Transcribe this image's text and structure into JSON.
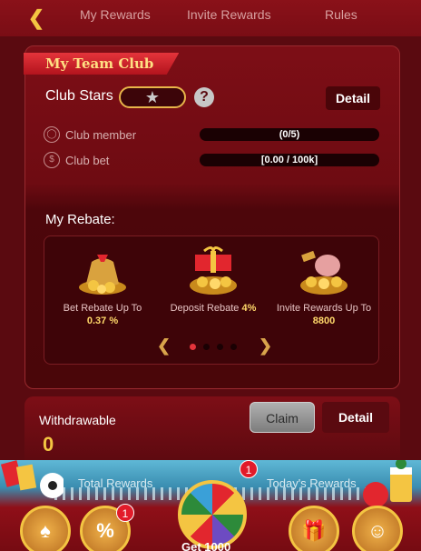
{
  "header": {
    "back_icon": "chevron-left-icon",
    "tabs": [
      "My Rewards",
      "Invite Rewards",
      "Rules"
    ]
  },
  "club": {
    "title": "My Team Club",
    "stars_label": "Club Stars",
    "detail_label": "Detail",
    "member_label": "Club member",
    "member_value": "(0/5)",
    "member_progress": 0,
    "bet_label": "Club bet",
    "bet_value": "[0.00 / 100k]",
    "bet_progress": 0
  },
  "rebate": {
    "title": "My Rebate:",
    "items": [
      {
        "caption": "Bet Rebate Up To",
        "value": "0.37 %"
      },
      {
        "caption": "Deposit Rebate",
        "value": "4%"
      },
      {
        "caption": "Invite Rewards Up To",
        "value": "8800"
      }
    ]
  },
  "withdraw": {
    "label": "Withdrawable",
    "value": "0",
    "claim_label": "Claim",
    "detail_label": "Detail"
  },
  "bottom": {
    "total_rewards": "Total Rewards",
    "todays_rewards": "Today's Rewards",
    "get_label": "Get 1000",
    "badge_left": "1",
    "badge_center": "1"
  },
  "colors": {
    "accent": "#e4343b",
    "gold": "#f4c542",
    "background": "#5a0a10"
  }
}
